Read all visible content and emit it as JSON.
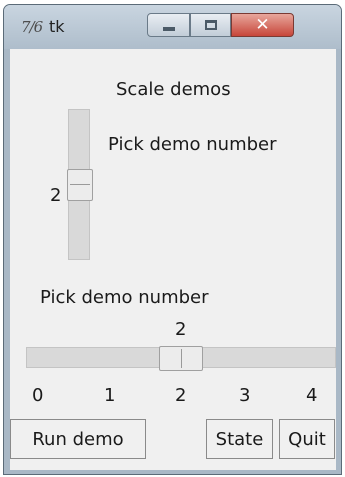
{
  "window": {
    "title": "tk",
    "app_icon": "7/6"
  },
  "scale_demos": {
    "header": "Scale demos",
    "vertical_label": "Pick demo number",
    "vertical_value": "2",
    "horizontal_label": "Pick demo number",
    "horizontal_value": "2",
    "value_fraction": 0.5,
    "ticks": [
      "0",
      "1",
      "2",
      "3",
      "4"
    ]
  },
  "buttons": {
    "run_demo": "Run demo",
    "state": "State",
    "quit": "Quit"
  },
  "titlebar_icons": {
    "minimize": "minimize-icon",
    "maximize": "maximize-icon",
    "close": "close-icon",
    "close_glyph": "✕"
  },
  "colors": {
    "window_bg": "#f0f0f0",
    "close_button": "#c7463a"
  }
}
